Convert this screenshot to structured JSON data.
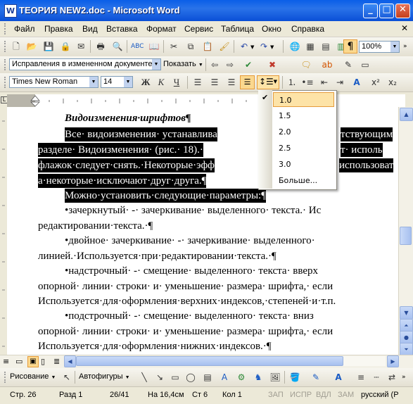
{
  "window": {
    "title": "ТЕОРИЯ NEW2.doc - Microsoft Word",
    "app_icon": "word-doc-icon",
    "controls": [
      "minimize",
      "maximize",
      "close"
    ]
  },
  "menu": [
    "Файл",
    "Правка",
    "Вид",
    "Вставка",
    "Формат",
    "Сервис",
    "Таблица",
    "Окно",
    "Справка"
  ],
  "standard_toolbar": {
    "zoom": "100%",
    "icons": [
      "new-doc-icon",
      "open-icon",
      "save-icon",
      "permission-icon",
      "email-icon",
      "print-icon",
      "print-preview-icon",
      "spelling-icon",
      "research-icon",
      "cut-icon",
      "copy-icon",
      "paste-icon",
      "format-painter-icon",
      "undo-icon",
      "redo-icon",
      "hyperlink-icon",
      "tables-borders-icon",
      "insert-table-icon",
      "insert-excel-icon",
      "columns-icon",
      "drawing-icon",
      "document-map-icon",
      "show-formatting-icon"
    ]
  },
  "reviewing_toolbar": {
    "display_mode": "Исправления в измененном документе",
    "show_label": "Показать"
  },
  "formatting_toolbar": {
    "font": "Times New Roman",
    "size": "14",
    "bold": "Ж",
    "italic": "К",
    "underline": "Ч"
  },
  "line_spacing_menu": {
    "options": [
      "1.0",
      "1.5",
      "2.0",
      "2.5",
      "3.0"
    ],
    "selected": "1.0",
    "more": "Больше..."
  },
  "document": {
    "lines": [
      {
        "text": "Видоизменения·шрифтов¶",
        "style": "heading"
      },
      {
        "text": "Все· видоизменения· устанавлива",
        "tail": "тствующим",
        "style": "selected"
      },
      {
        "text": "разделе· Видоизменения· (рис.· 18).·",
        "tail": "т· исполь",
        "style": "selected"
      },
      {
        "text": "флажок·следует·снять.·Некоторые·эфф",
        "tail": "использоват",
        "style": "selected"
      },
      {
        "text": "а·некоторые·исключают·друг·друга.¶",
        "style": "selected"
      },
      {
        "text": "Можно·установить·следующие·параметры:¶",
        "style": "selected"
      },
      {
        "text": "•зачеркнутый· -· зачеркивание· выделенного· текста.· Ис",
        "style": "normal"
      },
      {
        "text": "редактировании·текста.·¶",
        "style": "normal"
      },
      {
        "text": "•двойное· зачеркивание· -· зачеркивание· выделенного·",
        "style": "normal"
      },
      {
        "text": "линией.·Используется·при·редактировании·текста.·¶",
        "style": "normal"
      },
      {
        "text": "•надстрочный· -· смещение· выделенного· текста· вверх",
        "style": "normal"
      },
      {
        "text": "опорной· линии· строки· и· уменьшение· размера· шрифта,· если",
        "style": "normal"
      },
      {
        "text": "Используется·для·оформления·верхних·индексов,·степеней·и·т.п.",
        "style": "normal"
      },
      {
        "text": "•подстрочный· -· смещение· выделенного· текста· вниз",
        "style": "normal"
      },
      {
        "text": "опорной· линии· строки· и· уменьшение· размера· шрифта,· если",
        "style": "normal"
      },
      {
        "text": "Используется·для·оформления·нижних·индексов.·¶",
        "style": "normal"
      }
    ]
  },
  "drawing_toolbar": {
    "drawing_label": "Рисование",
    "autoshapes_label": "Автофигуры"
  },
  "status": {
    "page": "Стр. 26",
    "section": "Разд 1",
    "pages": "26/41",
    "position": "На 16,4см",
    "line": "Ст 6",
    "column": "Кол 1",
    "rec": "ЗАП",
    "trk": "ИСПР",
    "ext": "ВДЛ",
    "ovr": "ЗАМ",
    "language": "русский (Р"
  }
}
